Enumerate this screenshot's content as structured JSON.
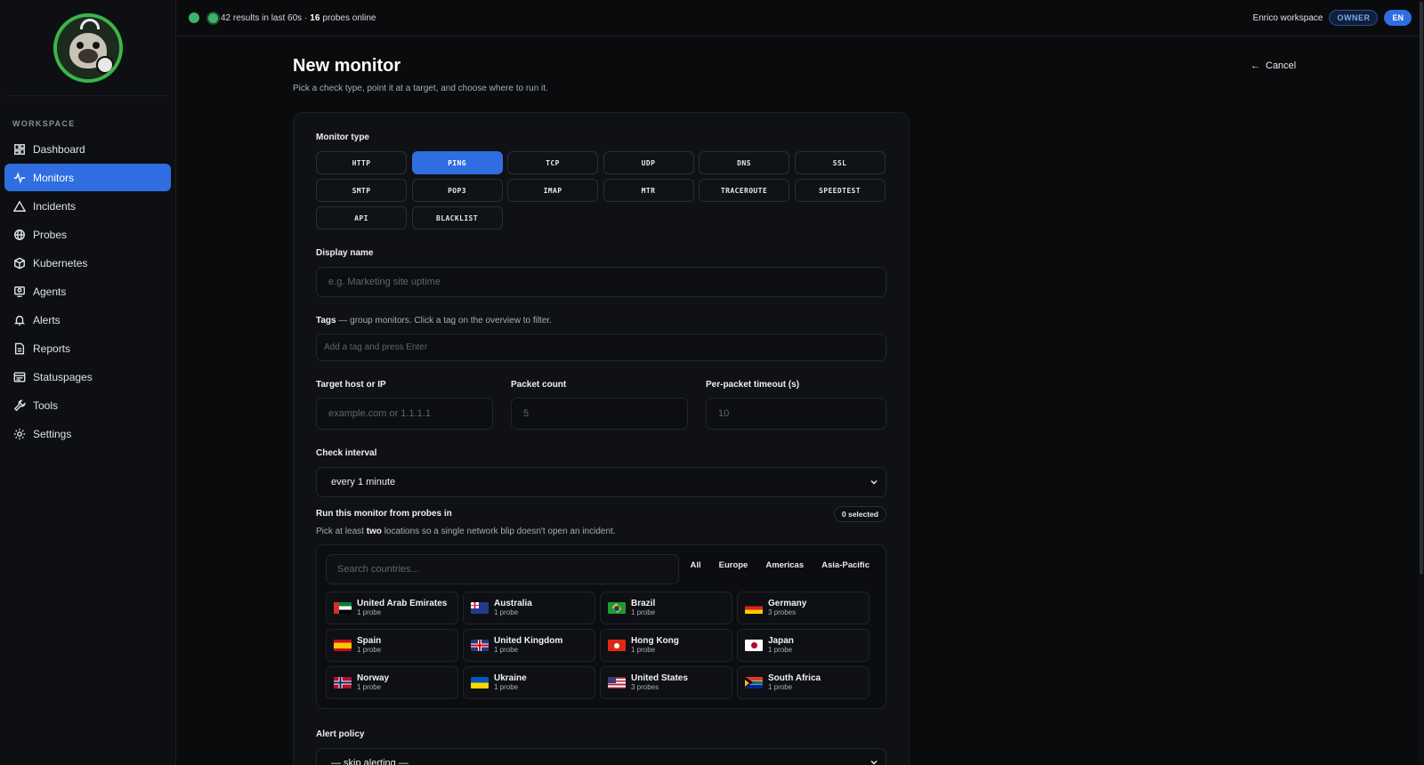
{
  "sidebar": {
    "section_label": "WORKSPACE",
    "items": [
      {
        "label": "Dashboard",
        "icon": "dashboard-icon"
      },
      {
        "label": "Monitors",
        "icon": "activity-icon"
      },
      {
        "label": "Incidents",
        "icon": "warning-icon"
      },
      {
        "label": "Probes",
        "icon": "globe-icon"
      },
      {
        "label": "Kubernetes",
        "icon": "cube-icon"
      },
      {
        "label": "Agents",
        "icon": "agent-icon"
      },
      {
        "label": "Alerts",
        "icon": "bell-icon"
      },
      {
        "label": "Reports",
        "icon": "document-icon"
      },
      {
        "label": "Statuspages",
        "icon": "statuspage-icon"
      },
      {
        "label": "Tools",
        "icon": "wrench-icon"
      },
      {
        "label": "Settings",
        "icon": "gear-icon"
      }
    ],
    "active_item": "Monitors"
  },
  "topbar": {
    "results_count": "42",
    "results_text": "results in last 60s ·",
    "probes_count": "16",
    "probes_text": "probes online",
    "workspace": "Enrico workspace",
    "role": "OWNER",
    "lang": "EN"
  },
  "page": {
    "title": "New monitor",
    "subtitle": "Pick a check type, point it at a target, and choose where to run it.",
    "cancel": "Cancel"
  },
  "form": {
    "monitor_type_label": "Monitor type",
    "types": [
      "HTTP",
      "PING",
      "TCP",
      "UDP",
      "DNS",
      "SSL",
      "SMTP",
      "POP3",
      "IMAP",
      "MTR",
      "TRACEROUTE",
      "SPEEDTEST",
      "API",
      "BLACKLIST"
    ],
    "selected_type": "PING",
    "display_name_label": "Display name",
    "display_name_placeholder": "e.g. Marketing site uptime",
    "tags_label": "Tags",
    "tags_hint": "— group monitors. Click a tag on the overview to filter.",
    "tags_placeholder": "Add a tag and press Enter",
    "target_label": "Target host or IP",
    "target_placeholder": "example.com or 1.1.1.1",
    "packet_label": "Packet count",
    "packet_placeholder": "5",
    "timeout_label": "Per-packet timeout (s)",
    "timeout_placeholder": "10",
    "interval_label": "Check interval",
    "interval_value": "every 1 minute",
    "probes_label": "Run this monitor from probes in",
    "selected_count": "0 selected",
    "probes_hint_pre": "Pick at least",
    "probes_hint_bold": "two",
    "probes_hint_post": "locations so a single network blip doesn't open an incident.",
    "search_placeholder": "Search countries...",
    "filters": [
      "All",
      "Europe",
      "Americas",
      "Asia-Pacific"
    ],
    "countries": [
      {
        "name": "United Arab Emirates",
        "count": "1 probe",
        "flag": "ae"
      },
      {
        "name": "Australia",
        "count": "1 probe",
        "flag": "au"
      },
      {
        "name": "Brazil",
        "count": "1 probe",
        "flag": "br"
      },
      {
        "name": "Germany",
        "count": "3 probes",
        "flag": "de"
      },
      {
        "name": "Spain",
        "count": "1 probe",
        "flag": "es"
      },
      {
        "name": "United Kingdom",
        "count": "1 probe",
        "flag": "gb"
      },
      {
        "name": "Hong Kong",
        "count": "1 probe",
        "flag": "hk"
      },
      {
        "name": "Japan",
        "count": "1 probe",
        "flag": "jp"
      },
      {
        "name": "Norway",
        "count": "1 probe",
        "flag": "no"
      },
      {
        "name": "Ukraine",
        "count": "1 probe",
        "flag": "ua"
      },
      {
        "name": "United States",
        "count": "3 probes",
        "flag": "us"
      },
      {
        "name": "South Africa",
        "count": "1 probe",
        "flag": "za"
      }
    ],
    "alert_policy_label": "Alert policy",
    "alert_policy_value": "— skip alerting —"
  },
  "colors": {
    "accent": "#2f6de1",
    "online": "#3bb36a",
    "background": "#0a0b0d"
  }
}
